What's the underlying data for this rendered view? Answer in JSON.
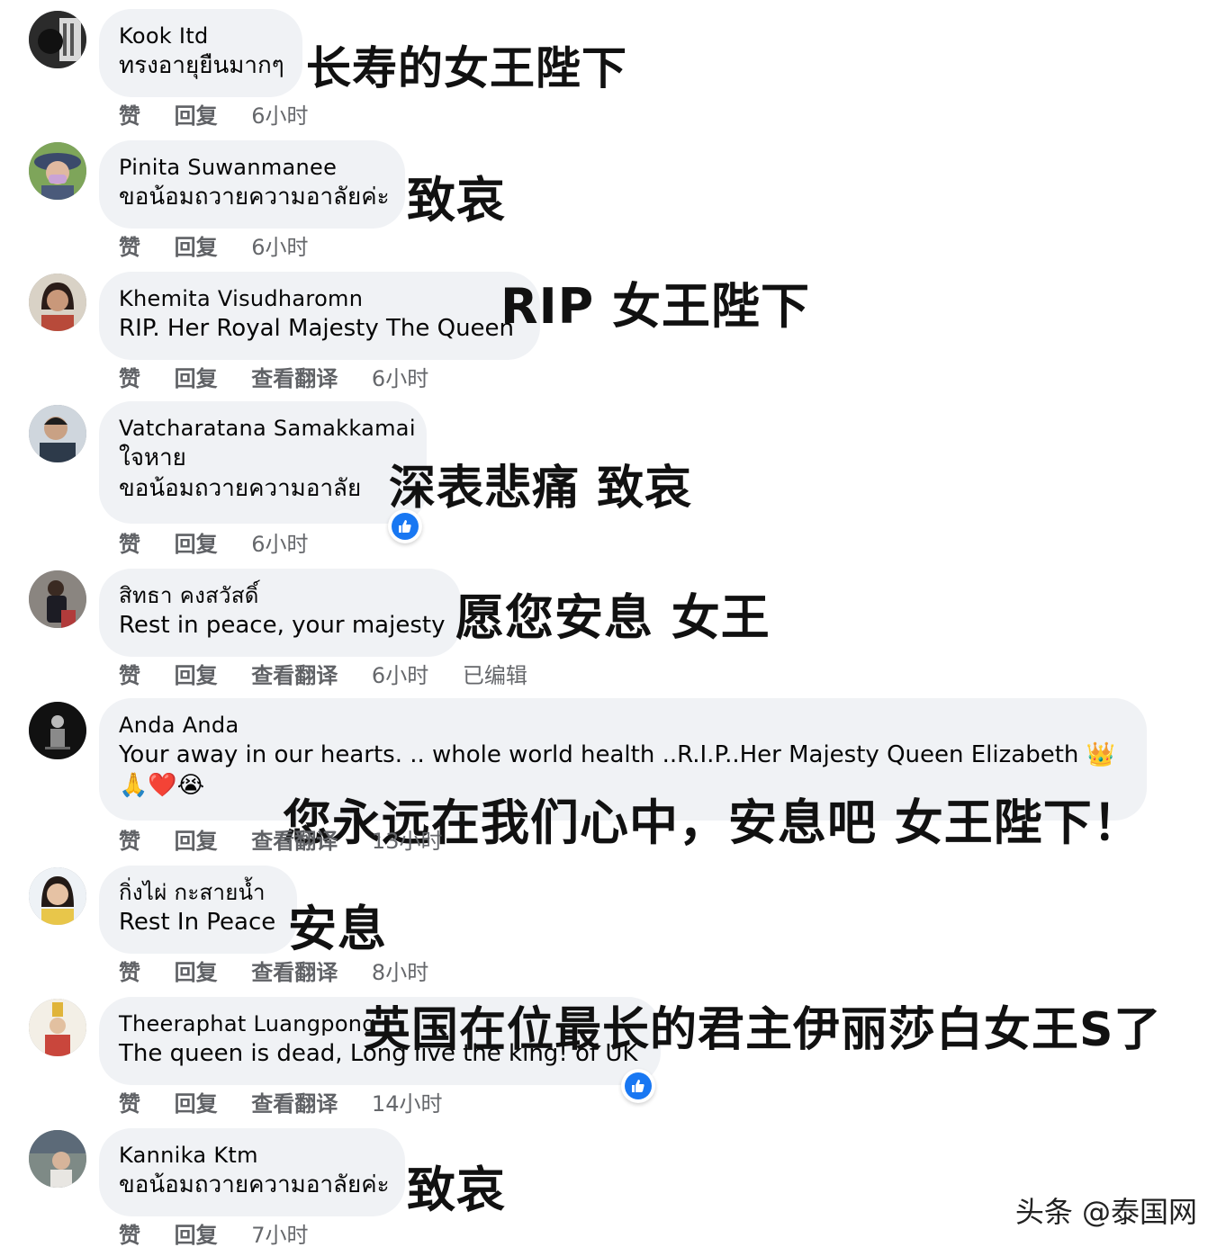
{
  "comments": [
    {
      "name": "Kook Itd",
      "text": [
        "ทรงอายุยืนมากๆ"
      ],
      "actions": [
        "赞",
        "回复"
      ],
      "time": "6小时",
      "overlay": "长寿的女王陛下"
    },
    {
      "name": "Pinita Suwanmanee",
      "text": [
        "ขอน้อมถวายความอาลัยค่ะ"
      ],
      "actions": [
        "赞",
        "回复"
      ],
      "time": "6小时",
      "overlay": "致哀"
    },
    {
      "name": "Khemita Visudharomn",
      "text": [
        "RIP. Her Royal Majesty The Queen"
      ],
      "actions": [
        "赞",
        "回复",
        "查看翻译"
      ],
      "time": "6小时",
      "overlay": "RIP 女王陛下"
    },
    {
      "name": "Vatcharatana Samakkamai",
      "text": [
        "ใจหาย",
        "ขอน้อมถวายความอาลัย"
      ],
      "actions": [
        "赞",
        "回复"
      ],
      "time": "6小时",
      "overlay": "深表悲痛 致哀",
      "reaction": "like"
    },
    {
      "name": "สิทธา คงสวัสดิ์",
      "text": [
        "Rest in peace, your majesty"
      ],
      "actions": [
        "赞",
        "回复",
        "查看翻译"
      ],
      "time": "6小时",
      "edited": "已编辑",
      "overlay": "愿您安息 女王"
    },
    {
      "name": "Anda Anda",
      "text": [
        "Your away in our hearts. .. whole world health ..R.I.P..Her Majesty Queen Elizabeth 👑",
        "🙏❤️😭"
      ],
      "actions": [
        "赞",
        "回复",
        "查看翻译"
      ],
      "time": "13小时",
      "overlay": "您永远在我们心中，安息吧 女王陛下！"
    },
    {
      "name": "กิ่งไผ่ กะสายน้ำ",
      "text": [
        "Rest In Peace"
      ],
      "actions": [
        "赞",
        "回复",
        "查看翻译"
      ],
      "time": "8小时",
      "overlay": "安息"
    },
    {
      "name": "Theeraphat Luangpong",
      "text": [
        "The queen is dead, Long live the king! of UK"
      ],
      "actions": [
        "赞",
        "回复",
        "查看翻译"
      ],
      "time": "14小时",
      "overlay": "英国在位最长的君主伊丽莎白女王S了",
      "reaction": "like"
    },
    {
      "name": "Kannika Ktm",
      "text": [
        "ขอน้อมถวายความอาลัยค่ะ"
      ],
      "actions": [
        "赞",
        "回复"
      ],
      "time": "7小时",
      "overlay": "致哀"
    }
  ],
  "watermark": "头条 @泰国网",
  "colors": {
    "bubble": "#f0f2f5",
    "meta": "#65676b",
    "like": "#1877f2"
  }
}
